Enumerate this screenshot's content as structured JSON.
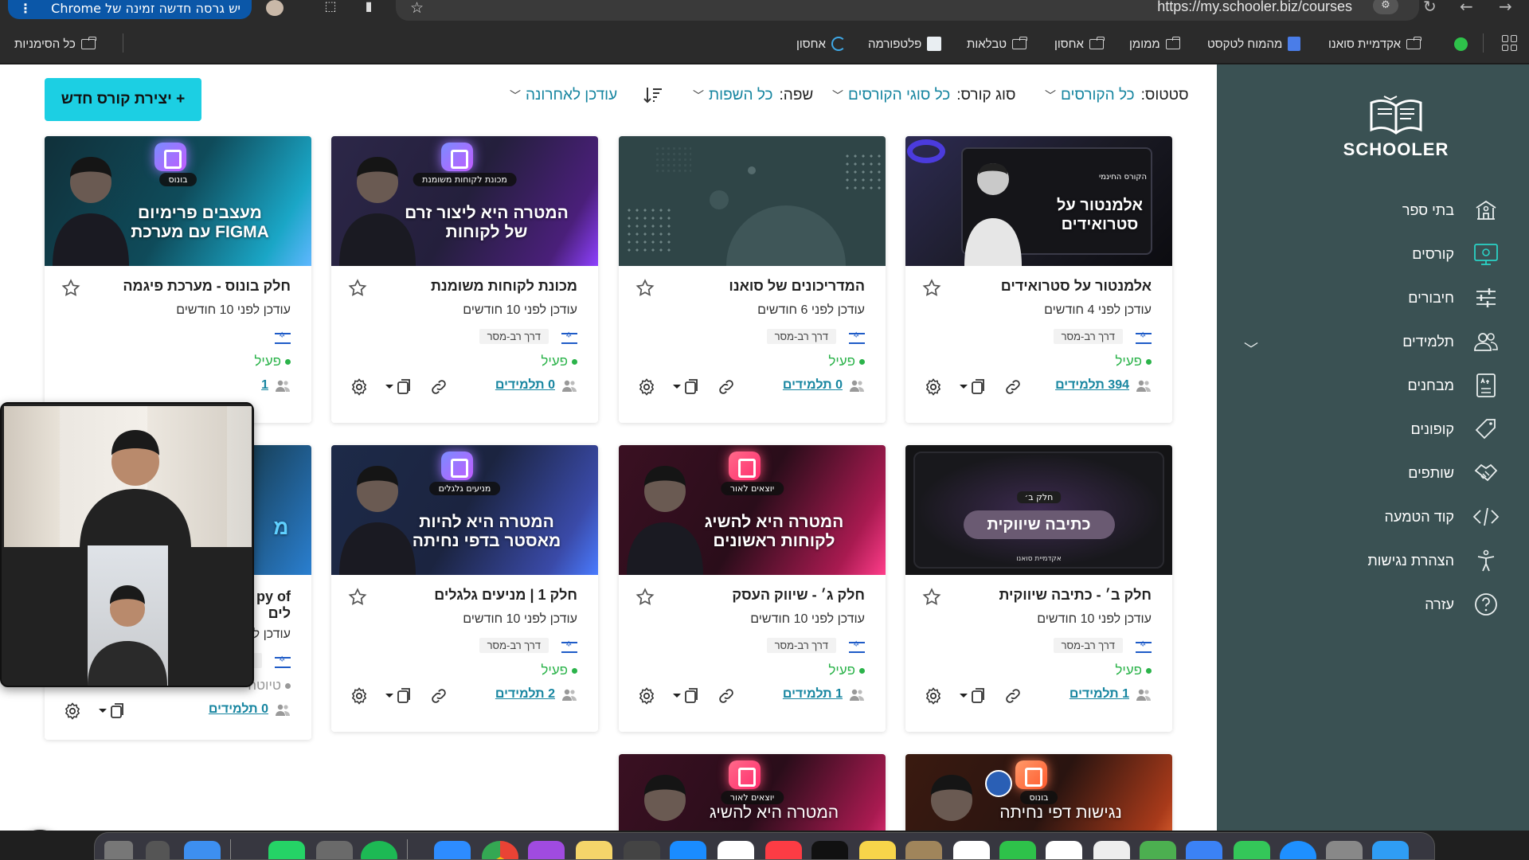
{
  "browser": {
    "update_banner": "יש גרסה חדשה זמינה של Chrome",
    "update_dots": "⋮",
    "url": "https://my.schooler.biz/courses"
  },
  "bookmarks": [
    {
      "label": "אקדמיית סואנו",
      "icon": "folder-icon"
    },
    {
      "label": "מהמוח לטקסט",
      "icon": "doc-icon"
    },
    {
      "label": "ממומן",
      "icon": "folder-icon"
    },
    {
      "label": "אחסון",
      "icon": "folder-icon"
    },
    {
      "label": "טבלאות",
      "icon": "folder-icon"
    },
    {
      "label": "פלטפורמה",
      "icon": "site-icon"
    },
    {
      "label": "אחסון",
      "icon": "sync-icon"
    }
  ],
  "all_bookmarks": "כל הסימניות",
  "sidebar": {
    "logo_text": "SCHOOLER",
    "items": [
      {
        "label": "בתי ספר",
        "icon": "school-icon"
      },
      {
        "label": "קורסים",
        "icon": "courses-icon"
      },
      {
        "label": "חיבורים",
        "icon": "sliders-icon"
      },
      {
        "label": "תלמידים",
        "icon": "users-icon"
      },
      {
        "label": "מבחנים",
        "icon": "exam-icon"
      },
      {
        "label": "קופונים",
        "icon": "tag-icon"
      },
      {
        "label": "שותפים",
        "icon": "handshake-icon"
      },
      {
        "label": "קוד הטמעה",
        "icon": "code-icon"
      },
      {
        "label": "הצהרת נגישות",
        "icon": "accessibility-icon"
      },
      {
        "label": "עזרה",
        "icon": "help-icon"
      }
    ]
  },
  "toolbar": {
    "new_course": "+ יצירת קורס חדש",
    "status_label": "סטטוס:",
    "status_value": "כל הקורסים",
    "type_label": "סוג קורס:",
    "type_value": "כל סוגי הקורסים",
    "lang_label": "שפה:",
    "lang_value": "כל השפות",
    "sort_value": "עודכן לאחרונה"
  },
  "cards": [
    {
      "title": "אלמנטור על סטרואידים",
      "thumb_text": "אלמנטור על סטרואידים",
      "thumb_tag": "הקורס החינמי",
      "updated": "עודכן לפני 4 חודשים",
      "type": "דרך רב-מסר",
      "status": "פעיל",
      "students": "394 תלמידים"
    },
    {
      "title": "המדריכונים של סואנו",
      "thumb_text": "",
      "thumb_tag": "",
      "updated": "עודכן לפני 6 חודשים",
      "type": "דרך רב-מסר",
      "status": "פעיל",
      "students": "0 תלמידים"
    },
    {
      "title": "מכונת לקוחות משומנת",
      "thumb_text": "המטרה היא ליצור זרם של לקוחות",
      "thumb_tag": "מכונת לקוחות משומנת",
      "updated": "עודכן לפני 10 חודשים",
      "type": "דרך רב-מסר",
      "status": "פעיל",
      "students": "0 תלמידים"
    },
    {
      "title": "חלק בונוס - מערכת פיגמה",
      "thumb_text": "מעצבים פרימיום FIGMA עם מערכת",
      "thumb_tag": "בונוס",
      "updated": "עודכן לפני 10 חודשים",
      "type": "",
      "status": "פעיל",
      "students": "1"
    },
    {
      "title": "חלק ב׳ - כתיבה שיווקית",
      "thumb_text": "כתיבה שיווקית",
      "thumb_tag": "חלק ב׳",
      "thumb_sub": "אקדמיית סואנו",
      "updated": "עודכן לפני 10 חודשים",
      "type": "דרך רב-מסר",
      "status": "פעיל",
      "students": "1 תלמידים"
    },
    {
      "title": "חלק ג׳ - שיווק העסק",
      "thumb_text": "המטרה היא להשיג לקוחות ראשונים",
      "thumb_tag": "יוצאים לאור",
      "updated": "עודכן לפני 10 חודשים",
      "type": "דרך רב-מסר",
      "status": "פעיל",
      "students": "1 תלמידים"
    },
    {
      "title": "חלק 1 | מניעים גלגלים",
      "thumb_text": "המטרה היא להיות מאסטר בדפי נחיתה",
      "thumb_tag": "מניעים גלגלים",
      "updated": "עודכן לפני 10 חודשים",
      "type": "דרך רב-מסר",
      "status": "פעיל",
      "students": "2 תלמידים"
    },
    {
      "title": "py of",
      "title2": "לים",
      "thumb_text": "מ",
      "thumb_tag": "",
      "updated": "עודכן לפני 10 חודשים",
      "type": "דרך רב-מסר",
      "status": "טיוטה",
      "students": "0 תלמידים"
    },
    {
      "title": "",
      "thumb_text": "המטרה היא להשיג",
      "thumb_tag": "יוצאים לאור",
      "updated": "",
      "type": "",
      "status": "",
      "students": ""
    },
    {
      "title": "",
      "thumb_text": "נגישות דפי נחיתה",
      "thumb_tag": "בונוס",
      "updated": "",
      "type": "",
      "status": "",
      "students": ""
    }
  ],
  "colors": {
    "accent": "#1ccfe3",
    "sidebar_bg": "#3a5153",
    "link": "#1685a0",
    "active_green": "#2bb34a",
    "draft_gray": "#999999"
  }
}
